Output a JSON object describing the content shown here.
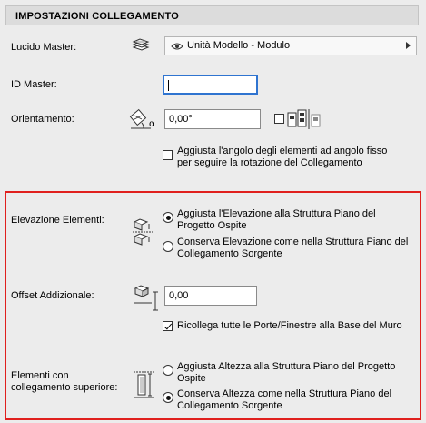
{
  "header": {
    "title": "IMPOSTAZIONI COLLEGAMENTO"
  },
  "lucido_master": {
    "label": "Lucido Master:",
    "value": "Unità Modello - Modulo",
    "icon": "layer-stack-icon",
    "eye_icon": "eye-icon"
  },
  "id_master": {
    "label": "ID Master:",
    "value": ""
  },
  "orientamento": {
    "label": "Orientamento:",
    "value": "0,00°",
    "icon": "angle-orientation-icon",
    "checkbox_checked": false,
    "checkbox_label": "Aggiusta l'angolo degli elementi ad angolo fisso per seguire la rotazione del Collegamento",
    "checkbox_line1": "Aggiusta l'angolo degli elementi ad angolo fisso",
    "checkbox_line2": "per seguire la rotazione del Collegamento"
  },
  "elevazione": {
    "label": "Elevazione Elementi:",
    "options": [
      {
        "line1": "Aggiusta l'Elevazione alla Struttura Piano del",
        "line2": "Progetto Ospite",
        "selected": true
      },
      {
        "line1": "Conserva Elevazione come nella Struttura Piano del",
        "line2": "Collegamento Sorgente",
        "selected": false
      }
    ]
  },
  "offset": {
    "label": "Offset Addizionale:",
    "value": "0,00",
    "checkbox_checked": true,
    "checkbox_label": "Ricollega tutte le Porte/Finestre alla Base del Muro"
  },
  "elementi_sup": {
    "label_line1": "Elementi con",
    "label_line2": "collegamento superiore:",
    "options": [
      {
        "line1": "Aggiusta Altezza alla Struttura Piano del Progetto",
        "line2": "Ospite",
        "selected": false
      },
      {
        "line1": "Conserva Altezza come nella Struttura Piano del",
        "line2": "Collegamento Sorgente",
        "selected": true
      }
    ]
  },
  "colors": {
    "highlight": "#e0201e",
    "focus": "#2f74d0",
    "panel": "#ececec"
  }
}
